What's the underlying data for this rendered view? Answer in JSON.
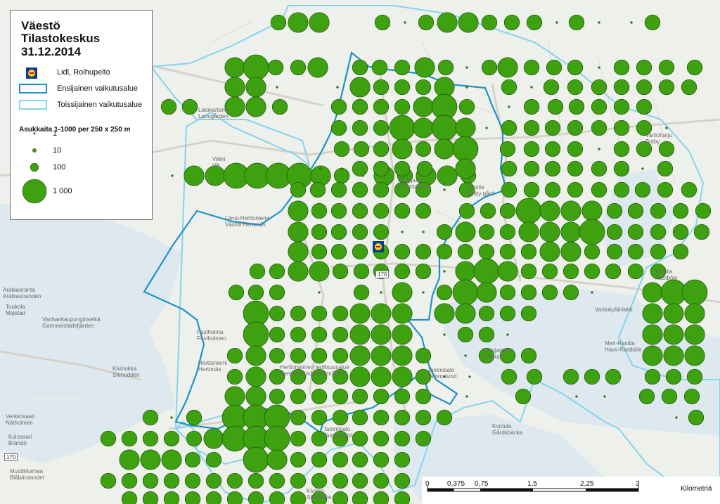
{
  "legend": {
    "title_line1": "Väestö",
    "title_line2": "Tilastokeskus",
    "title_line3": "31.12.2014",
    "store_label": "Lidl, Roihupelto",
    "primary_area_label": "Ensijainen vaikutusalue",
    "secondary_area_label": "Toissijainen vaikutusalue",
    "dots_title": "Asukkaita 1-1000 per 250 x 250 m",
    "dot_1": "1",
    "dot_10": "10",
    "dot_100": "100",
    "dot_1000": "1 000"
  },
  "colors": {
    "dot_fill": "#3ea10f",
    "dot_stroke": "#1f4f0a",
    "primary_area": "#1d93c8",
    "secondary_area": "#85d3ee",
    "water": "#dde9ee",
    "land": "#eef0ec"
  },
  "scale_bar": {
    "ticks": [
      "0",
      "0,375",
      "0,75",
      "1,5",
      "2,25",
      "3"
    ],
    "unit": "Kilometriä"
  },
  "store_icon": "lidl-store-icon",
  "places": [
    {
      "name": "Latokartano",
      "sub": "Ladugården"
    },
    {
      "name": "Viikki",
      "sub": "Vik"
    },
    {
      "name": "Länsi-Herttoniemi",
      "sub": "Västra Hertonäs"
    },
    {
      "name": "Fastholma",
      "sub": "Fastholmen"
    },
    {
      "name": "Herttoniemi",
      "sub": "Hertonäs"
    },
    {
      "name": "Arabianranta",
      "sub": "Arabiastranden"
    },
    {
      "name": "Toukola",
      "sub": "Majstad"
    },
    {
      "name": "Vanhankaupunginselkä",
      "sub": "Gammelstadsfjärden"
    },
    {
      "name": "Kivinokka",
      "sub": "Stenudden"
    },
    {
      "name": "Verkkosaari",
      "sub": "Nätholmen"
    },
    {
      "name": "Kulosaari",
      "sub": "Brändö"
    },
    {
      "name": "Mustikkamaa",
      "sub": "Blåbärslandet"
    },
    {
      "name": "Myllypuro",
      "sub": "Kvarnbäcken"
    },
    {
      "name": "Puotila",
      "sub": "Botby gård"
    },
    {
      "name": "Rastila",
      "sub": "Rastböle"
    },
    {
      "name": "Meri-Rastila",
      "sub": "Havs-Rastböle"
    },
    {
      "name": "Marjaniemi",
      "sub": "Marudd"
    },
    {
      "name": "Tammisalo",
      "sub": "Tammelund"
    },
    {
      "name": "Vartiokylänlahti",
      "sub": ""
    },
    {
      "name": "Kivikko",
      "sub": "Stensböle"
    },
    {
      "name": "Kontula",
      "sub": "Gårdsbacka"
    },
    {
      "name": "Vartioharju",
      "sub": "Botby"
    },
    {
      "name": "Herttoniemen teollisuusalue",
      "sub": "Hertonäs industriområde"
    },
    {
      "name": "Tammisalo",
      "sub": "Tammelund"
    }
  ],
  "road_labels": [
    "170",
    "170"
  ]
}
